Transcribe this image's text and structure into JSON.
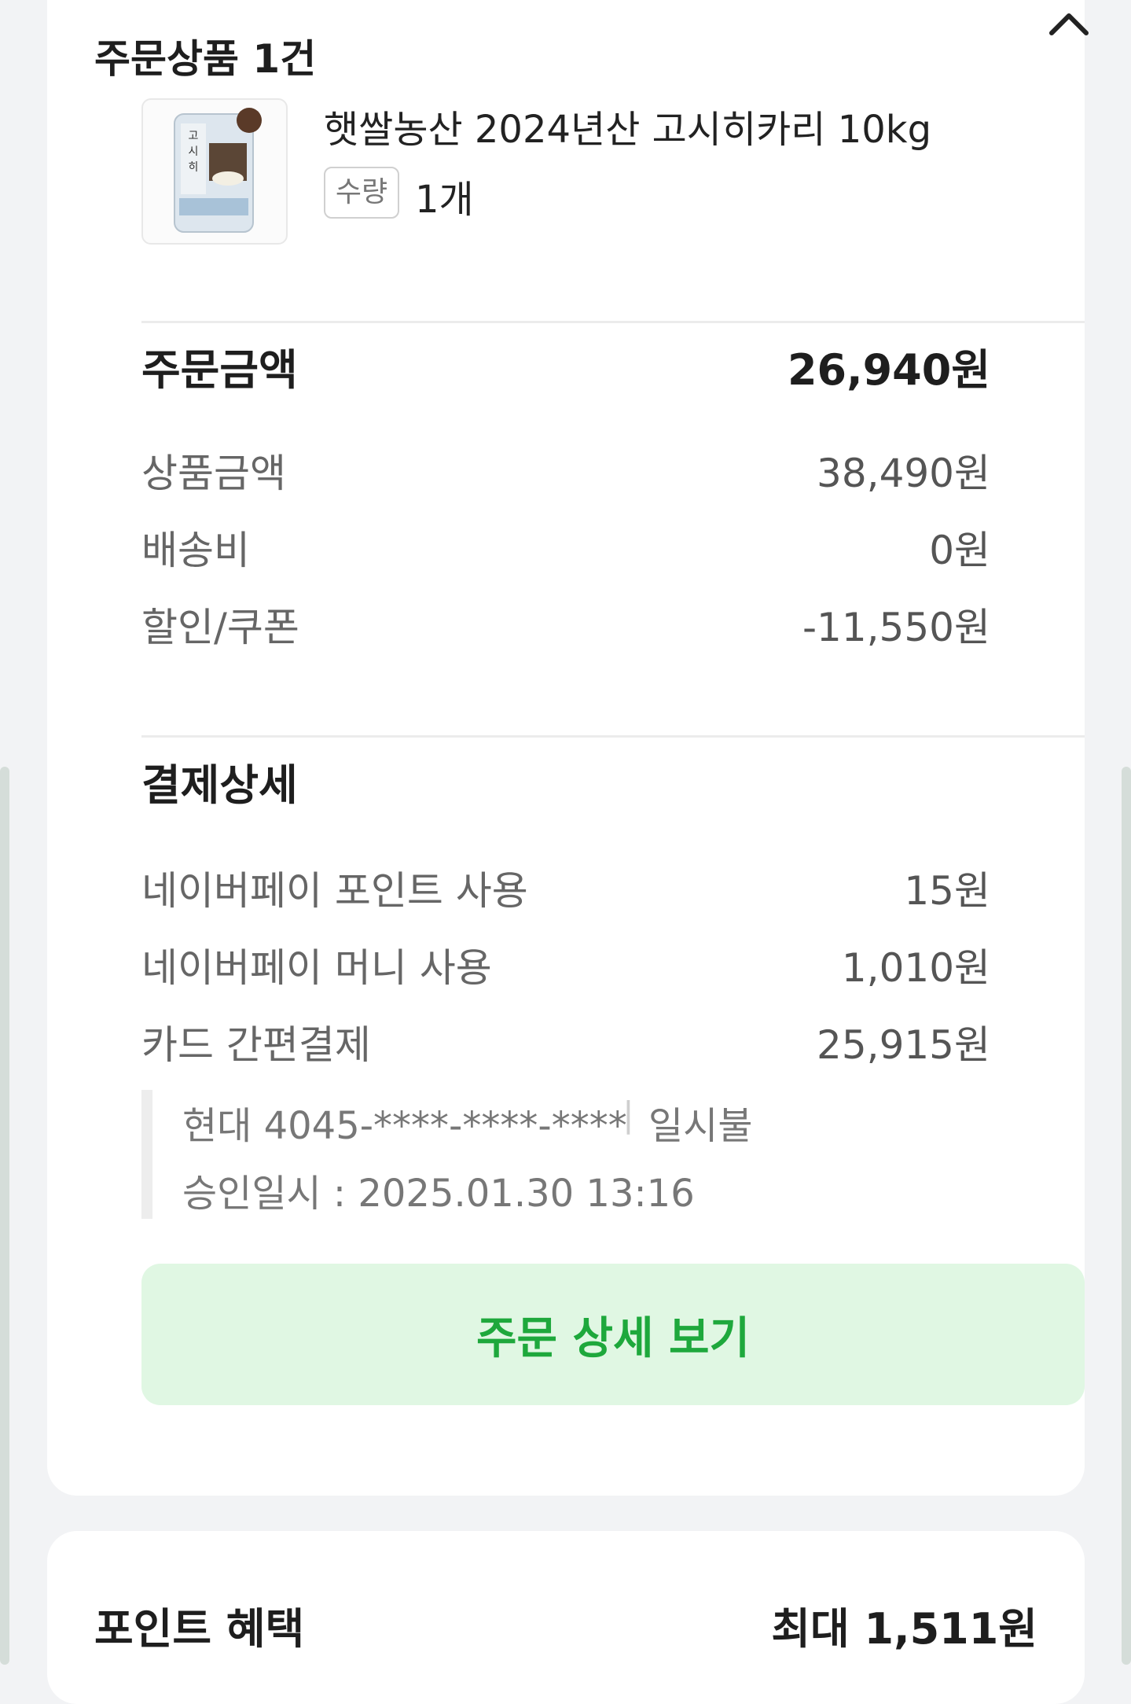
{
  "order_items": {
    "title": "주문상품 1건",
    "product": {
      "name": "햇쌀농산 2024년산 고시히카리 10kg",
      "quantity_label": "수량",
      "quantity_value": "1개",
      "thumbnail_text": "고시히카리",
      "thumbnail_icon": "rice-bag-icon"
    },
    "collapse_icon": "chevron-up-icon"
  },
  "order_amount": {
    "title": "주문금액",
    "total": "26,940원",
    "rows": [
      {
        "label": "상품금액",
        "value": "38,490원"
      },
      {
        "label": "배송비",
        "value": "0원"
      },
      {
        "label": "할인/쿠폰",
        "value": "-11,550원"
      }
    ]
  },
  "payment_detail": {
    "title": "결제상세",
    "rows": [
      {
        "label": "네이버페이 포인트 사용",
        "value": "15원"
      },
      {
        "label": "네이버페이 머니 사용",
        "value": "1,010원"
      },
      {
        "label": "카드 간편결제",
        "value": "25,915원"
      }
    ],
    "card_info": "현대 4045-****-****-****",
    "separator": "|",
    "installment": "일시불",
    "approval": "승인일시 : 2025.01.30 13:16"
  },
  "order_detail_button": {
    "label": "주문 상세 보기"
  },
  "points": {
    "title": "포인트 혜택",
    "value": "최대 1,511원"
  },
  "colors": {
    "button_bg": "#e0f7e3",
    "button_text": "#1ea83c",
    "page_bg": "#f2f3f5"
  }
}
